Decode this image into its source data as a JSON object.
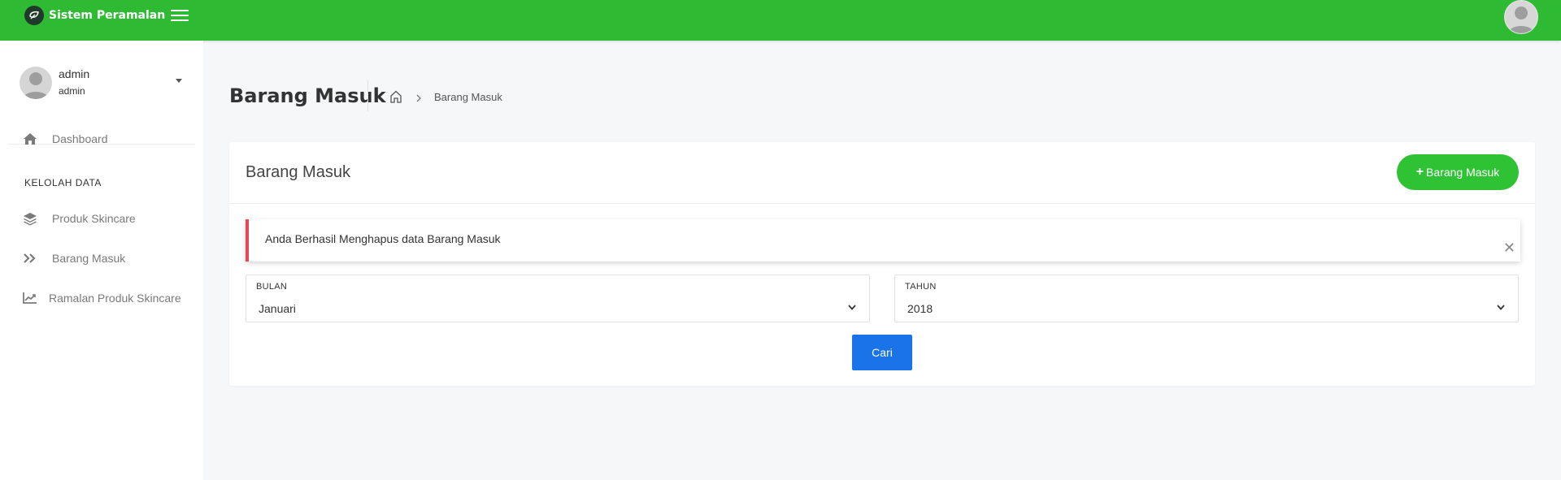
{
  "topbar": {
    "brand": "Sistem Peramalan",
    "logo_icon": "leaf-logo-icon",
    "menu_icon": "hamburger-icon",
    "avatar_icon": "user-avatar-icon",
    "background": "#2fba34"
  },
  "sidebar": {
    "user": {
      "name": "admin",
      "role": "admin"
    },
    "items": [
      {
        "label": "Dashboard",
        "icon": "home-icon"
      },
      {
        "label": "Produk Skincare",
        "icon": "layers-icon"
      },
      {
        "label": "Barang Masuk",
        "icon": "double-chevron-icon"
      },
      {
        "label": "Ramalan Produk Skincare",
        "icon": "line-chart-icon"
      }
    ],
    "section_label": "KELOLAH DATA"
  },
  "page": {
    "title": "Barang Masuk",
    "breadcrumb_current": "Barang Masuk"
  },
  "card": {
    "title": "Barang Masuk",
    "add_button": "Barang Masuk",
    "add_button_color": "#2fc235",
    "alert_text": "Anda Berhasil Menghapus data Barang Masuk",
    "alert_accent": "#e64756",
    "month": {
      "label": "BULAN",
      "value": "Januari"
    },
    "year": {
      "label": "TAHUN",
      "value": "2018"
    },
    "search_button": "Cari",
    "search_button_color": "#1a73e8"
  }
}
